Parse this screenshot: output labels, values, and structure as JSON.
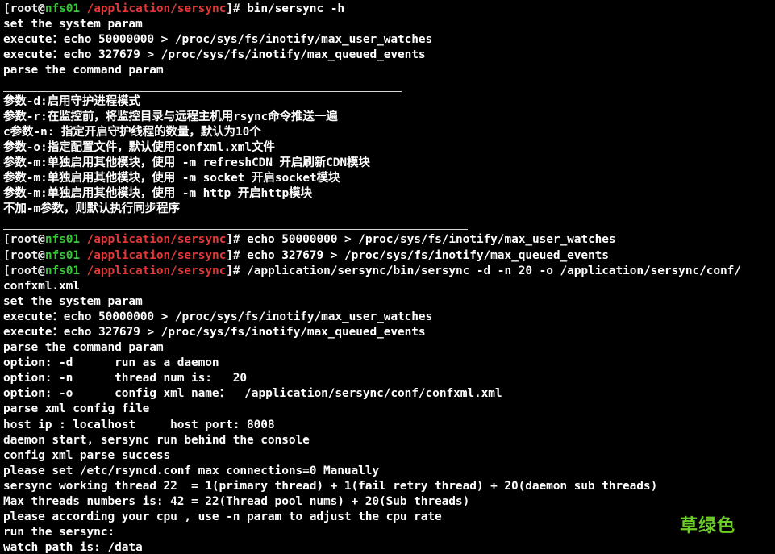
{
  "window": {
    "watermark": "草绿色"
  },
  "prompt": {
    "user": "root",
    "at": "@",
    "host": "nfs01",
    "cwd": "/application/sersync",
    "open": "[",
    "close": "]",
    "symbol": "#"
  },
  "colors": {
    "background": "#000000",
    "text": "#ffffff",
    "host": "#37c837",
    "path": "#e23838",
    "watermark": "#6ccf26"
  },
  "lines": [
    {
      "kind": "prompt",
      "cmd": "bin/sersync -h"
    },
    {
      "kind": "text",
      "text": "set the system param"
    },
    {
      "kind": "text",
      "text": "execute：echo 50000000 > /proc/sys/fs/inotify/max_user_watches"
    },
    {
      "kind": "text",
      "text": "execute：echo 327679 > /proc/sys/fs/inotify/max_queued_events"
    },
    {
      "kind": "text",
      "text": "parse the command param"
    },
    {
      "kind": "sep",
      "width": 494
    },
    {
      "kind": "text",
      "text": "参数-d:启用守护进程模式"
    },
    {
      "kind": "text",
      "text": "参数-r:在监控前，将监控目录与远程主机用rsync命令推送一遍"
    },
    {
      "kind": "text",
      "text": "c参数-n: 指定开启守护线程的数量，默认为10个"
    },
    {
      "kind": "text",
      "text": "参数-o:指定配置文件，默认使用confxml.xml文件"
    },
    {
      "kind": "text",
      "text": "参数-m:单独启用其他模块，使用 -m refreshCDN 开启刷新CDN模块"
    },
    {
      "kind": "text",
      "text": "参数-m:单独启用其他模块，使用 -m socket 开启socket模块"
    },
    {
      "kind": "text",
      "text": "参数-m:单独启用其他模块，使用 -m http 开启http模块"
    },
    {
      "kind": "text",
      "text": "不加-m参数，则默认执行同步程序"
    },
    {
      "kind": "sep",
      "width": 576
    },
    {
      "kind": "prompt",
      "cmd": "echo 50000000 > /proc/sys/fs/inotify/max_user_watches"
    },
    {
      "kind": "prompt",
      "cmd": "echo 327679 > /proc/sys/fs/inotify/max_queued_events"
    },
    {
      "kind": "prompt",
      "cmd": "/application/sersync/bin/sersync -d -n 20 -o /application/sersync/conf/"
    },
    {
      "kind": "text",
      "text": "confxml.xml"
    },
    {
      "kind": "text",
      "text": "set the system param"
    },
    {
      "kind": "text",
      "text": "execute：echo 50000000 > /proc/sys/fs/inotify/max_user_watches"
    },
    {
      "kind": "text",
      "text": "execute：echo 327679 > /proc/sys/fs/inotify/max_queued_events"
    },
    {
      "kind": "text",
      "text": "parse the command param"
    },
    {
      "kind": "text",
      "text": "option: -d      run as a daemon"
    },
    {
      "kind": "text",
      "text": "option: -n      thread num is:   20"
    },
    {
      "kind": "text",
      "text": "option: -o      config xml name：  /application/sersync/conf/confxml.xml"
    },
    {
      "kind": "text",
      "text": "parse xml config file"
    },
    {
      "kind": "text",
      "text": "host ip : localhost     host port: 8008"
    },
    {
      "kind": "text",
      "text": "daemon start, sersync run behind the console"
    },
    {
      "kind": "text",
      "text": "config xml parse success"
    },
    {
      "kind": "text",
      "text": "please set /etc/rsyncd.conf max connections=0 Manually"
    },
    {
      "kind": "text",
      "text": "sersync working thread 22  = 1(primary thread) + 1(fail retry thread) + 20(daemon sub threads)"
    },
    {
      "kind": "text",
      "text": "Max threads numbers is: 42 = 22(Thread pool nums) + 20(Sub threads)"
    },
    {
      "kind": "text",
      "text": "please according your cpu , use -n param to adjust the cpu rate"
    },
    {
      "kind": "text",
      "text": "run the sersync:"
    },
    {
      "kind": "text",
      "text": "watch path is: /data"
    }
  ]
}
